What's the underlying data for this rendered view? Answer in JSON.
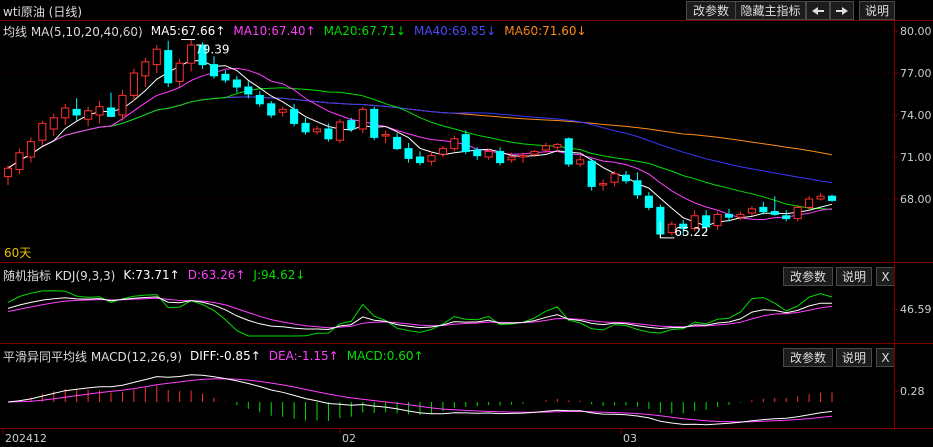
{
  "window": {
    "title": "wti原油 (日线)"
  },
  "toolbar": {
    "params_label": "改参数",
    "hide_main_label": "隐藏主指标",
    "prev_icon": "arrow-left-icon",
    "next_icon": "arrow-right-icon",
    "help_label": "说明"
  },
  "ma_panel": {
    "title": "均线 MA(5,10,20,40,60)",
    "ma5": "MA5:67.66↑",
    "ma10": "MA10:67.40↑",
    "ma20": "MA20:67.71↓",
    "ma40": "MA40:69.85↓",
    "ma60": "MA60:71.60↓",
    "period_label": "60天",
    "high_label": "79.39",
    "low_label": "65.22",
    "yticks": [
      "80.00",
      "77.00",
      "74.00",
      "71.00",
      "68.00"
    ],
    "colors": {
      "ma5": "#ffffff",
      "ma10": "#ff40ff",
      "ma20": "#00e000",
      "ma40": "#3838ff",
      "ma60": "#ff8c1a",
      "up": "#ff3030",
      "down": "#00ffff"
    }
  },
  "kdj_panel": {
    "title": "随机指标 KDJ(9,3,3)",
    "k": "K:73.71↑",
    "d": "D:63.26↑",
    "j": "J:94.62↓",
    "params_label": "改参数",
    "help_label": "说明",
    "close_label": "X",
    "ytick": "46.59"
  },
  "macd_panel": {
    "title": "平滑异同平均线 MACD(12,26,9)",
    "diff": "DIFF:-0.85↑",
    "dea": "DEA:-1.15↑",
    "macd": "MACD:0.60↑",
    "params_label": "改参数",
    "help_label": "说明",
    "close_label": "X",
    "ytick": "0.28"
  },
  "xaxis": {
    "labels": [
      "202412",
      "02",
      "03"
    ]
  },
  "chart_data": {
    "type": "candlestick",
    "ohlc": [
      [
        69.6,
        70.4,
        69.0,
        70.2
      ],
      [
        70.1,
        71.6,
        69.8,
        71.3
      ],
      [
        71.0,
        72.4,
        70.6,
        72.1
      ],
      [
        72.2,
        73.6,
        71.8,
        73.4
      ],
      [
        73.0,
        74.1,
        72.5,
        73.8
      ],
      [
        73.8,
        74.8,
        73.3,
        74.5
      ],
      [
        74.4,
        75.2,
        73.6,
        74.0
      ],
      [
        73.7,
        74.6,
        73.2,
        74.3
      ],
      [
        74.0,
        75.0,
        73.4,
        74.6
      ],
      [
        74.5,
        75.6,
        73.9,
        73.9
      ],
      [
        74.0,
        75.8,
        73.6,
        75.4
      ],
      [
        75.4,
        77.3,
        75.0,
        77.0
      ],
      [
        76.8,
        78.1,
        76.0,
        77.8
      ],
      [
        77.6,
        79.0,
        77.0,
        78.7
      ],
      [
        78.6,
        79.3,
        76.0,
        76.3
      ],
      [
        76.4,
        78.0,
        76.0,
        77.7
      ],
      [
        77.7,
        79.39,
        77.1,
        79.0
      ],
      [
        79.0,
        79.2,
        77.3,
        77.6
      ],
      [
        77.6,
        78.2,
        76.6,
        76.8
      ],
      [
        76.9,
        77.2,
        76.3,
        76.5
      ],
      [
        76.5,
        76.8,
        75.6,
        76.0
      ],
      [
        76.0,
        76.4,
        75.2,
        75.5
      ],
      [
        75.4,
        75.7,
        74.6,
        74.8
      ],
      [
        74.8,
        75.0,
        73.8,
        74.0
      ],
      [
        74.2,
        74.6,
        73.9,
        74.4
      ],
      [
        74.4,
        74.8,
        73.2,
        73.4
      ],
      [
        73.4,
        73.8,
        72.6,
        72.8
      ],
      [
        72.8,
        73.2,
        72.6,
        73.0
      ],
      [
        73.0,
        73.4,
        72.1,
        72.3
      ],
      [
        72.2,
        73.7,
        72.0,
        73.5
      ],
      [
        73.6,
        73.8,
        72.8,
        73.0
      ],
      [
        73.0,
        74.6,
        72.7,
        74.4
      ],
      [
        74.4,
        74.6,
        72.2,
        72.4
      ],
      [
        72.5,
        72.9,
        72.0,
        72.6
      ],
      [
        72.4,
        72.7,
        71.5,
        71.6
      ],
      [
        71.6,
        72.0,
        70.6,
        70.9
      ],
      [
        71.0,
        71.4,
        70.4,
        70.6
      ],
      [
        70.7,
        71.4,
        70.4,
        71.1
      ],
      [
        71.2,
        71.8,
        71.0,
        71.6
      ],
      [
        71.6,
        72.5,
        71.4,
        72.3
      ],
      [
        72.6,
        72.9,
        71.2,
        71.4
      ],
      [
        71.5,
        71.7,
        70.8,
        71.1
      ],
      [
        71.0,
        71.6,
        70.8,
        71.4
      ],
      [
        71.4,
        71.7,
        70.4,
        70.6
      ],
      [
        70.8,
        71.3,
        70.6,
        71.0
      ],
      [
        71.0,
        71.3,
        70.6,
        71.1
      ],
      [
        71.2,
        71.5,
        71.0,
        71.4
      ],
      [
        71.5,
        72.0,
        71.3,
        71.8
      ],
      [
        71.7,
        72.0,
        71.4,
        71.9
      ],
      [
        72.3,
        72.4,
        70.3,
        70.5
      ],
      [
        70.5,
        71.1,
        70.3,
        70.8
      ],
      [
        70.7,
        70.9,
        68.6,
        68.9
      ],
      [
        69.0,
        69.4,
        68.6,
        69.1
      ],
      [
        69.2,
        70.0,
        68.9,
        69.8
      ],
      [
        69.7,
        70.0,
        69.1,
        69.3
      ],
      [
        69.3,
        69.9,
        68.0,
        68.3
      ],
      [
        68.2,
        68.5,
        67.2,
        67.4
      ],
      [
        67.4,
        67.6,
        65.22,
        65.5
      ],
      [
        65.6,
        66.4,
        65.4,
        66.2
      ],
      [
        66.2,
        66.5,
        65.4,
        65.9
      ],
      [
        65.9,
        67.2,
        65.7,
        66.8
      ],
      [
        66.8,
        67.2,
        65.6,
        66.0
      ],
      [
        66.1,
        67.1,
        65.8,
        66.9
      ],
      [
        66.9,
        67.3,
        66.4,
        66.7
      ],
      [
        66.7,
        67.1,
        66.5,
        66.9
      ],
      [
        67.0,
        67.5,
        66.8,
        67.3
      ],
      [
        67.4,
        67.8,
        66.9,
        67.1
      ],
      [
        67.1,
        68.2,
        66.8,
        66.9
      ],
      [
        66.8,
        67.2,
        66.4,
        66.6
      ],
      [
        66.6,
        67.6,
        66.4,
        67.4
      ],
      [
        67.4,
        68.2,
        67.2,
        68.0
      ],
      [
        68.0,
        68.4,
        67.9,
        68.2
      ],
      [
        68.2,
        68.3,
        67.8,
        67.9
      ]
    ],
    "ylim": [
      63.5,
      80.5
    ]
  }
}
